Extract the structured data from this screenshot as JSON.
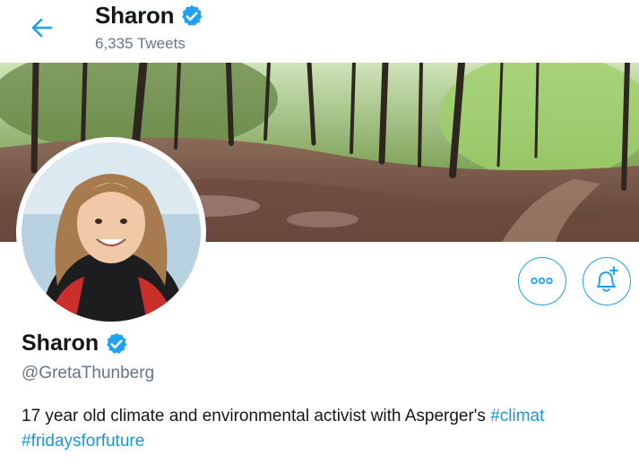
{
  "header": {
    "name": "Sharon",
    "tweet_count": "6,335 Tweets"
  },
  "profile": {
    "name": "Sharon",
    "handle": "@GretaThunberg",
    "bio_text": "17 year old climate and environmental activist with Asperger's ",
    "bio_hashtag_1": "#climat",
    "bio_hashtag_2": "#fridaysforfuture"
  },
  "icons": {
    "back": "left-arrow-icon",
    "verified": "verified-badge-icon",
    "more": "more-options-icon",
    "notify": "notification-bell-plus-icon"
  },
  "colors": {
    "accent": "#1da1f2",
    "link": "#1b95e0",
    "secondary_text": "#657786",
    "primary_text": "#14171a"
  }
}
